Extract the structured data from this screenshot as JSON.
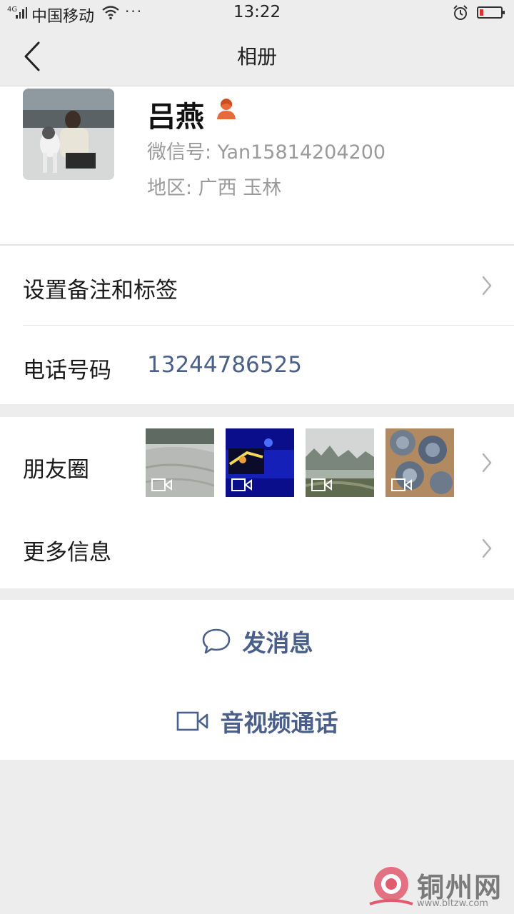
{
  "status_bar": {
    "network": "4G",
    "carrier": "中国移动",
    "dots": "···",
    "time": "13:22"
  },
  "nav": {
    "title": "相册",
    "back_icon": "chevron-left-icon"
  },
  "profile": {
    "name": "吕燕",
    "gender_icon": "female-person-icon",
    "wechat_id": "微信号: Yan15814204200",
    "region": "地区: 广西 玉林"
  },
  "rows": {
    "remark": "设置备注和标签",
    "phone_label": "电话号码",
    "phone_value": "13244786525",
    "moments": "朋友圈",
    "more_info": "更多信息"
  },
  "actions": {
    "message": "发消息",
    "call": "音视频通话"
  },
  "watermark": {
    "name": "铜州网",
    "url": "www.bltzw.com"
  },
  "colors": {
    "accent": "#4a5f8a",
    "background": "#ededed",
    "gender": "#e86a3a"
  }
}
